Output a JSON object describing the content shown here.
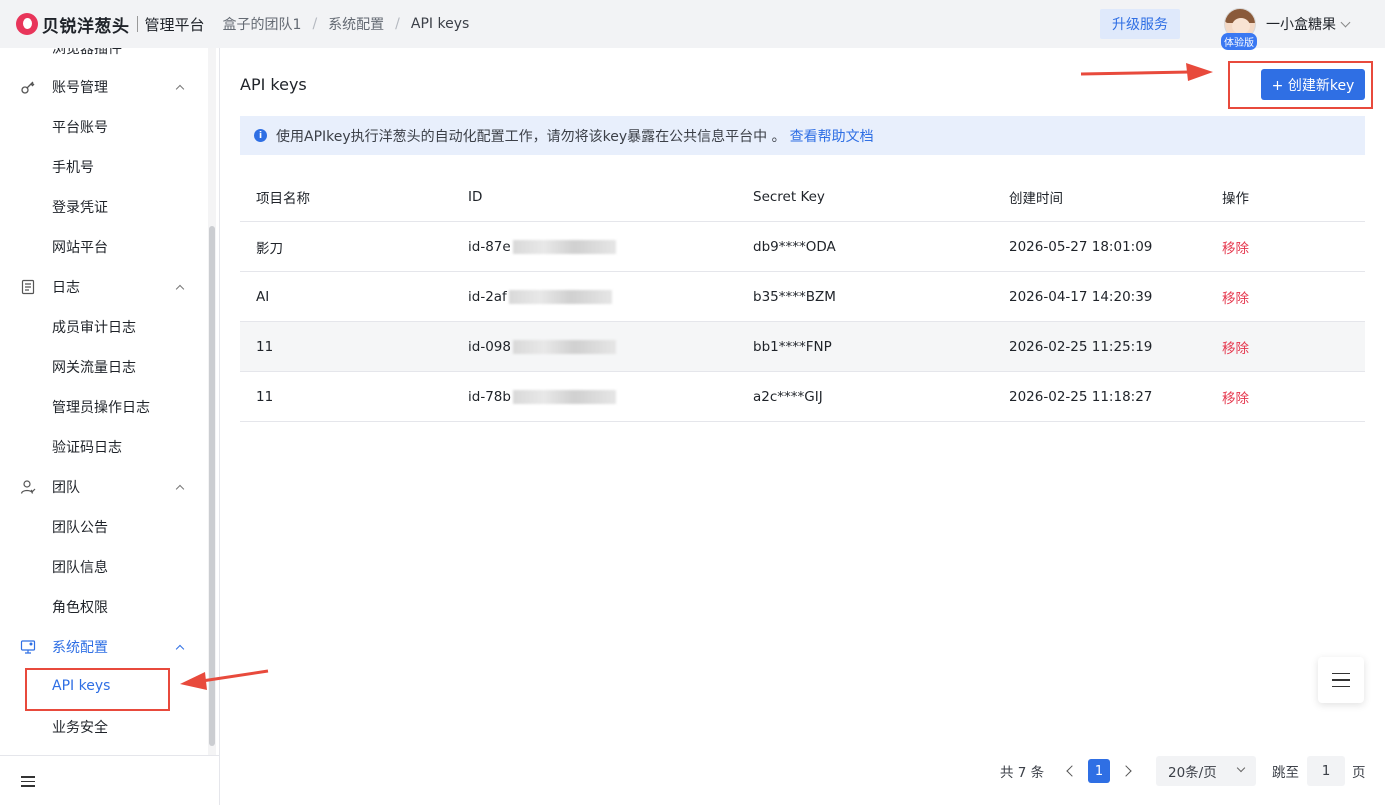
{
  "header": {
    "logo_text": "贝锐洋葱头",
    "logo_sub": "管理平台",
    "breadcrumb": [
      "盒子的团队1",
      "系统配置",
      "API keys"
    ],
    "upgrade_label": "升级服务",
    "user_name": "一小盒糖果",
    "trial_badge": "体验版"
  },
  "sidebar": {
    "partial_top_label": "浏览器插件",
    "groups": [
      {
        "label": "账号管理",
        "icon": "key-icon",
        "items": [
          "平台账号",
          "手机号",
          "登录凭证",
          "网站平台"
        ]
      },
      {
        "label": "日志",
        "icon": "log-icon",
        "items": [
          "成员审计日志",
          "网关流量日志",
          "管理员操作日志",
          "验证码日志"
        ]
      },
      {
        "label": "团队",
        "icon": "team-icon",
        "items": [
          "团队公告",
          "团队信息",
          "角色权限"
        ]
      },
      {
        "label": "系统配置",
        "icon": "monitor-icon",
        "items": [
          "API keys",
          "业务安全"
        ]
      }
    ]
  },
  "main": {
    "title": "API keys",
    "create_button": "+ 创建新key",
    "alert_text": "使用APIkey执行洋葱头的自动化配置工作，请勿将该key暴露在公共信息平台中 。",
    "alert_link": "查看帮助文档",
    "table": {
      "headers": [
        "项目名称",
        "ID",
        "Secret Key",
        "创建时间",
        "操作"
      ],
      "rows": [
        {
          "name": "影刀",
          "id": "id-87e",
          "secret": "db9****ODA",
          "created": "2026-05-27 18:01:09",
          "action": "移除"
        },
        {
          "name": "AI",
          "id": "id-2af",
          "secret": "b35****BZM",
          "created": "2026-04-17 14:20:39",
          "action": "移除"
        },
        {
          "name": "11",
          "id": "id-098",
          "secret": "bb1****FNP",
          "created": "2026-02-25 11:25:19",
          "action": "移除"
        },
        {
          "name": "11",
          "id": "id-78b",
          "secret": "a2c****GIJ",
          "created": "2026-02-25 11:18:27",
          "action": "移除"
        }
      ]
    },
    "pagination": {
      "total": "共 7 条",
      "current_page": "1",
      "page_size": "20条/页",
      "jump_label": "跳至",
      "jump_value": "1",
      "page_suffix": "页"
    }
  },
  "colors": {
    "accent": "#2f6fe4",
    "danger": "#e5374d",
    "annotation": "#e84a3c"
  }
}
